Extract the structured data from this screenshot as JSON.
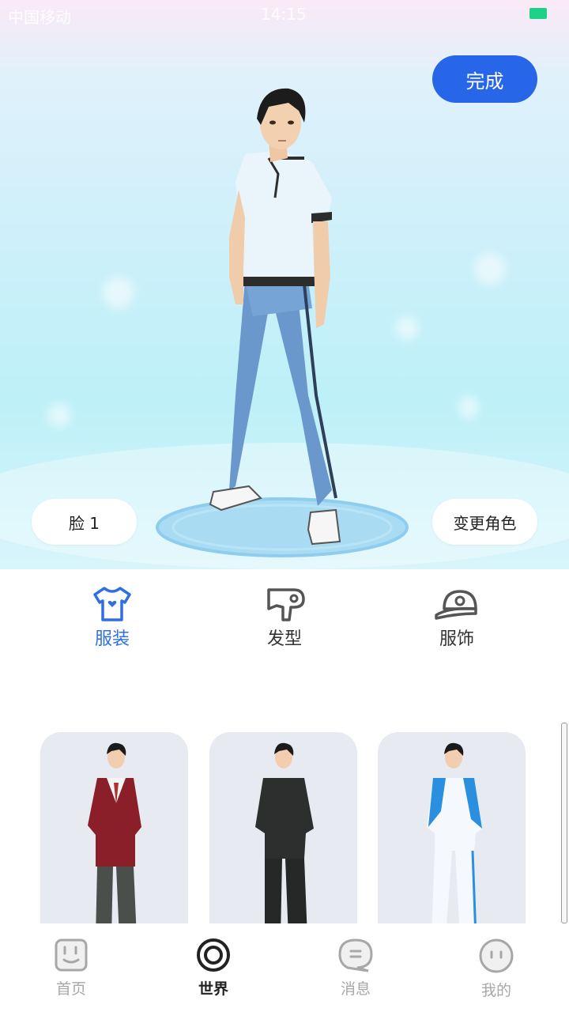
{
  "status_bar": {
    "carrier": "中国移动",
    "time": "14:15"
  },
  "header": {
    "done_label": "完成"
  },
  "scene": {
    "face_label": "脸 1",
    "change_role_label": "变更角色"
  },
  "categories": [
    {
      "label": "服装",
      "icon": "tshirt-icon",
      "active": true
    },
    {
      "label": "发型",
      "icon": "hair-dryer-icon",
      "active": false
    },
    {
      "label": "服饰",
      "icon": "cap-icon",
      "active": false
    }
  ],
  "outfits": [
    {
      "name": "red-blazer-outfit"
    },
    {
      "name": "black-school-uniform-outfit"
    },
    {
      "name": "blue-white-tracksuit-outfit"
    }
  ],
  "bottom_nav": [
    {
      "label": "首页",
      "icon": "home-face-icon",
      "active": false
    },
    {
      "label": "世界",
      "icon": "world-ring-icon",
      "active": true
    },
    {
      "label": "消息",
      "icon": "message-bubble-icon",
      "active": false
    },
    {
      "label": "我的",
      "icon": "profile-face-icon",
      "active": false
    }
  ],
  "colors": {
    "accent": "#2766e8",
    "active_tab": "#2f6fe0",
    "inactive_nav": "#a7a7a7"
  }
}
